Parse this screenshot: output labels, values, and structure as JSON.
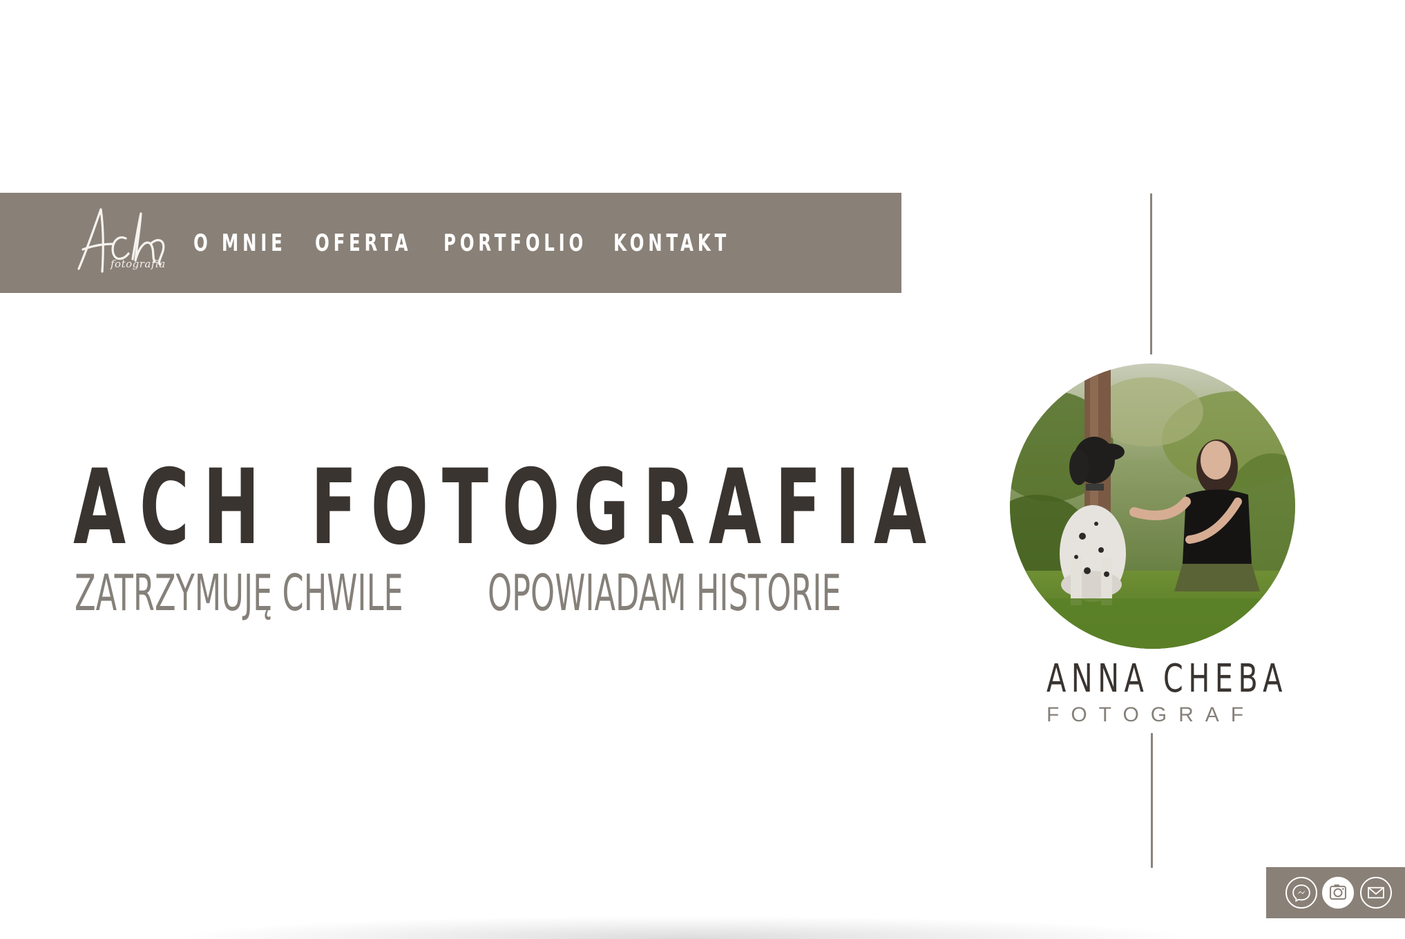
{
  "header": {
    "logo": {
      "script_text": "Ach",
      "subtitle": "fotografia"
    },
    "nav": [
      {
        "label": "O MNIE"
      },
      {
        "label": "OFERTA"
      },
      {
        "label": "PORTFOLIO"
      },
      {
        "label": "KONTAKT"
      }
    ]
  },
  "hero": {
    "title": "ACH FOTOGRAFIA",
    "subtitle_left": "ZATRZYMUJĘ CHWILE",
    "subtitle_right": "OPOWIADAM HISTORIE"
  },
  "profile": {
    "name": "ANNA CHEBA",
    "role": "FOTOGRAF",
    "photo_icon": "portrait-photo"
  },
  "social": [
    {
      "icon": "messenger-icon"
    },
    {
      "icon": "instagram-camera-icon"
    },
    {
      "icon": "mail-icon"
    }
  ],
  "colors": {
    "brand": "#898077",
    "text_dark": "#3a3430",
    "text_muted": "#858079",
    "background": "#ffffff"
  }
}
